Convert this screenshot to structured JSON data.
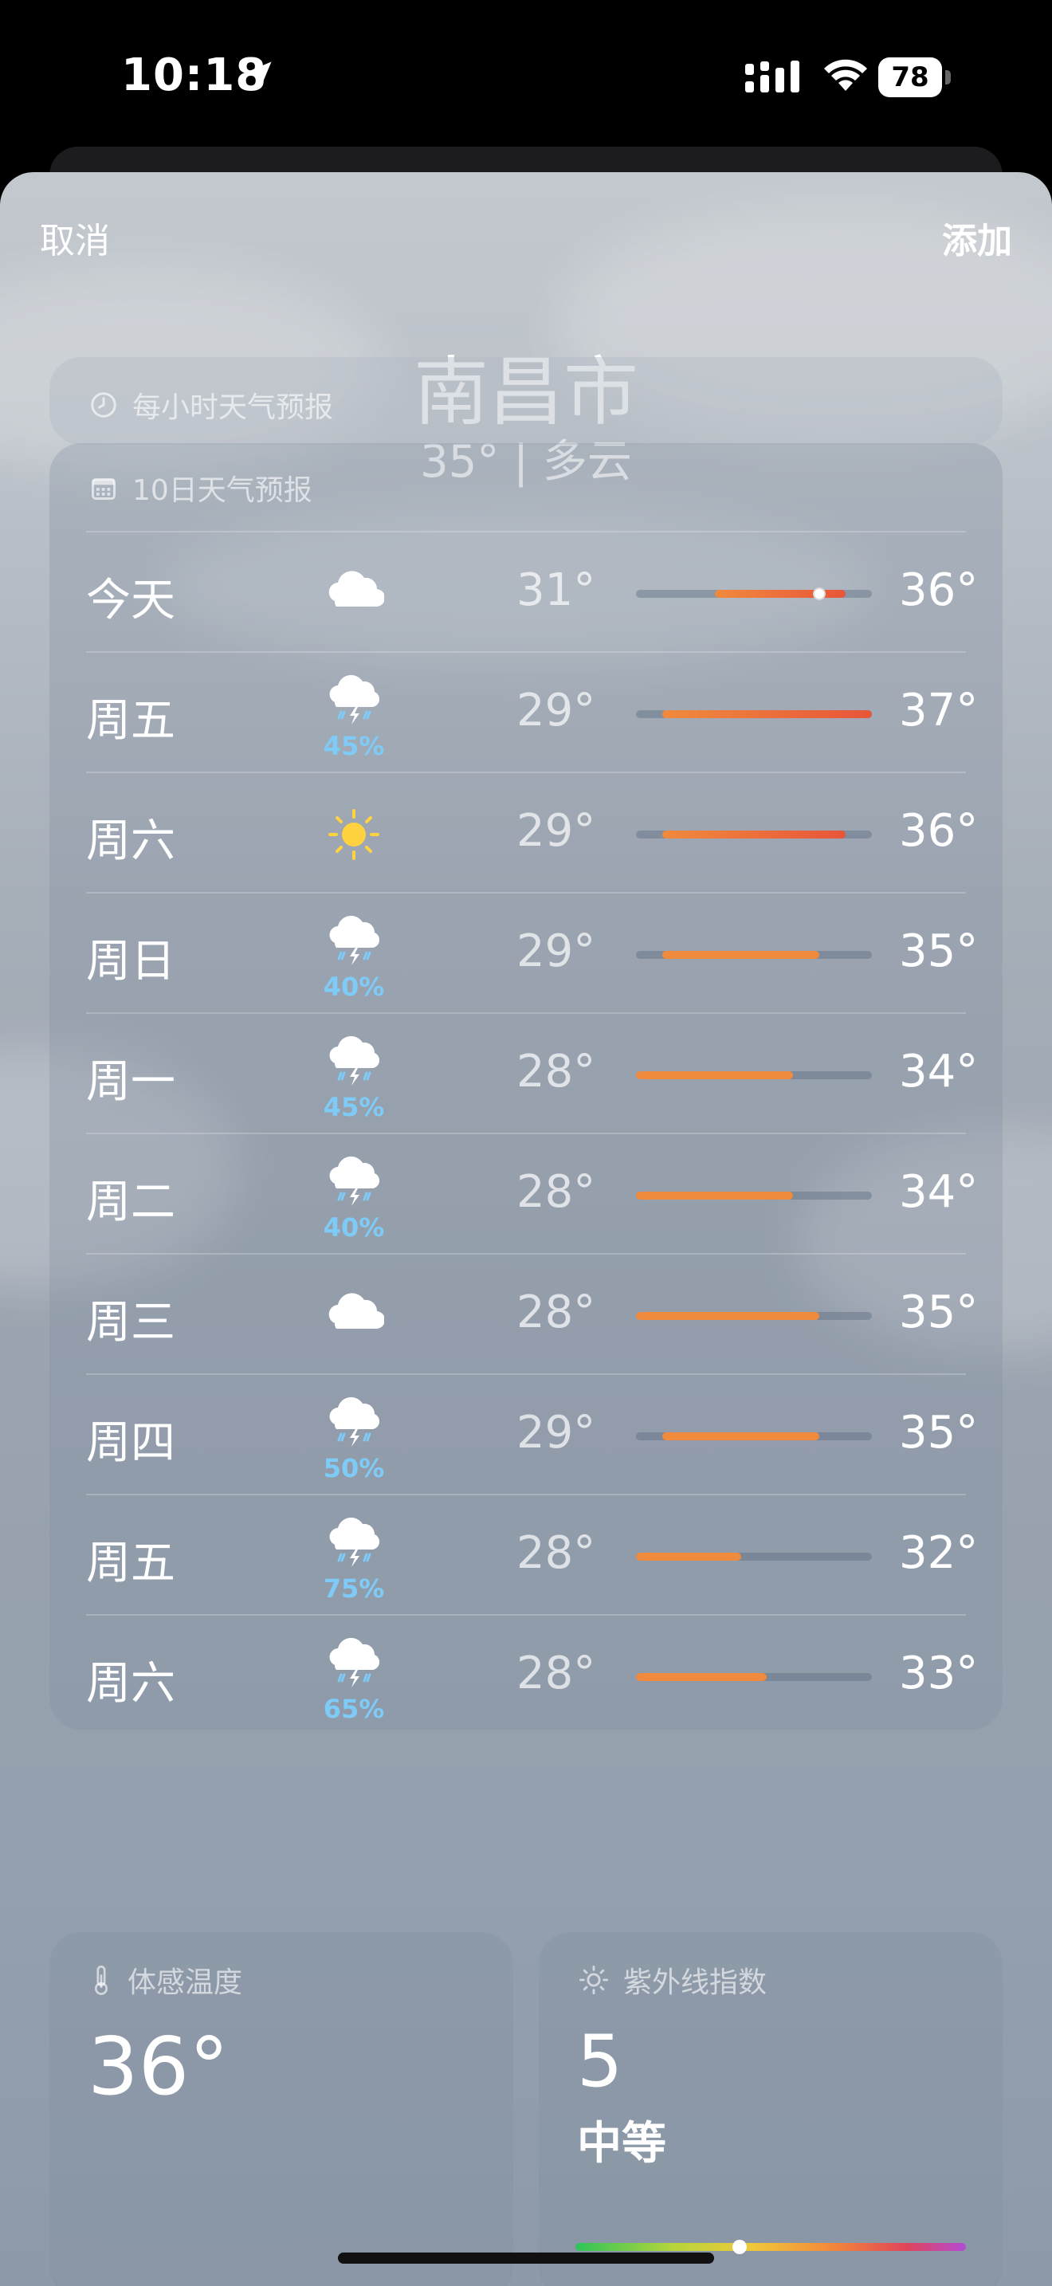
{
  "status_bar": {
    "time": "10:18",
    "battery": "78"
  },
  "nav": {
    "cancel_label": "取消",
    "add_label": "添加"
  },
  "location": {
    "city": "南昌市",
    "summary": "35° | 多云"
  },
  "hourly": {
    "title": "每小时天气预报"
  },
  "ten_day": {
    "title": "10日天气预报",
    "range_min": 28,
    "range_max": 37,
    "current_temp": 35,
    "rows": [
      {
        "day": "今天",
        "icon": "cloud-icon",
        "precip": "",
        "low": "31°",
        "high": "36°",
        "low_v": 31,
        "high_v": 36,
        "current": true
      },
      {
        "day": "周五",
        "icon": "thunderstorm-icon",
        "precip": "45%",
        "low": "29°",
        "high": "37°",
        "low_v": 29,
        "high_v": 37
      },
      {
        "day": "周六",
        "icon": "sun-icon",
        "precip": "",
        "low": "29°",
        "high": "36°",
        "low_v": 29,
        "high_v": 36
      },
      {
        "day": "周日",
        "icon": "thunderstorm-icon",
        "precip": "40%",
        "low": "29°",
        "high": "35°",
        "low_v": 29,
        "high_v": 35
      },
      {
        "day": "周一",
        "icon": "thunderstorm-icon",
        "precip": "45%",
        "low": "28°",
        "high": "34°",
        "low_v": 28,
        "high_v": 34
      },
      {
        "day": "周二",
        "icon": "thunderstorm-icon",
        "precip": "40%",
        "low": "28°",
        "high": "34°",
        "low_v": 28,
        "high_v": 34
      },
      {
        "day": "周三",
        "icon": "cloud-icon",
        "precip": "",
        "low": "28°",
        "high": "35°",
        "low_v": 28,
        "high_v": 35
      },
      {
        "day": "周四",
        "icon": "thunderstorm-icon",
        "precip": "50%",
        "low": "29°",
        "high": "35°",
        "low_v": 29,
        "high_v": 35
      },
      {
        "day": "周五",
        "icon": "thunderstorm-icon",
        "precip": "75%",
        "low": "28°",
        "high": "32°",
        "low_v": 28,
        "high_v": 32
      },
      {
        "day": "周六",
        "icon": "thunderstorm-icon",
        "precip": "65%",
        "low": "28°",
        "high": "33°",
        "low_v": 28,
        "high_v": 33
      }
    ]
  },
  "feels_like": {
    "title": "体感温度",
    "value": "36°"
  },
  "uv_index": {
    "title": "紫外线指数",
    "value": "5",
    "level": "中等",
    "position_fraction": 0.42
  },
  "colors": {
    "precip": "#7ecbf7",
    "bar_orange": "#f08a3c",
    "bar_red": "#e8553a",
    "sun": "#ffd23f"
  }
}
